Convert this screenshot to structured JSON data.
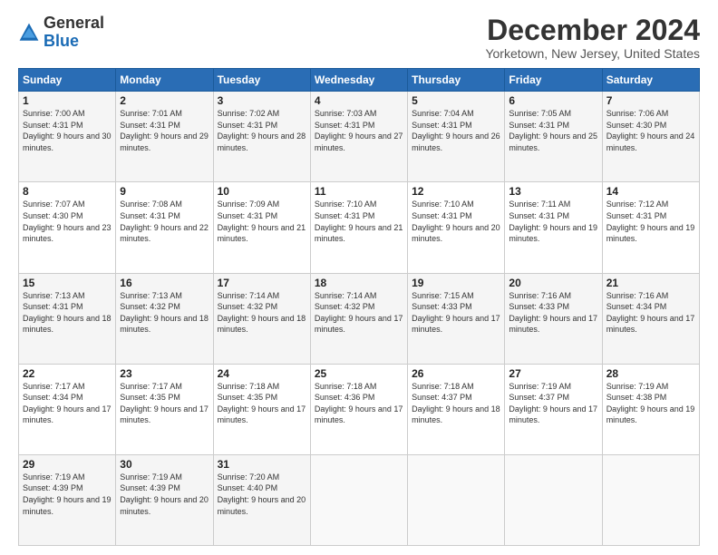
{
  "logo": {
    "general": "General",
    "blue": "Blue"
  },
  "title": "December 2024",
  "location": "Yorketown, New Jersey, United States",
  "days_header": [
    "Sunday",
    "Monday",
    "Tuesday",
    "Wednesday",
    "Thursday",
    "Friday",
    "Saturday"
  ],
  "weeks": [
    [
      {
        "day": "1",
        "sunrise": "7:00 AM",
        "sunset": "4:31 PM",
        "daylight": "9 hours and 30 minutes."
      },
      {
        "day": "2",
        "sunrise": "7:01 AM",
        "sunset": "4:31 PM",
        "daylight": "9 hours and 29 minutes."
      },
      {
        "day": "3",
        "sunrise": "7:02 AM",
        "sunset": "4:31 PM",
        "daylight": "9 hours and 28 minutes."
      },
      {
        "day": "4",
        "sunrise": "7:03 AM",
        "sunset": "4:31 PM",
        "daylight": "9 hours and 27 minutes."
      },
      {
        "day": "5",
        "sunrise": "7:04 AM",
        "sunset": "4:31 PM",
        "daylight": "9 hours and 26 minutes."
      },
      {
        "day": "6",
        "sunrise": "7:05 AM",
        "sunset": "4:31 PM",
        "daylight": "9 hours and 25 minutes."
      },
      {
        "day": "7",
        "sunrise": "7:06 AM",
        "sunset": "4:30 PM",
        "daylight": "9 hours and 24 minutes."
      }
    ],
    [
      {
        "day": "8",
        "sunrise": "7:07 AM",
        "sunset": "4:30 PM",
        "daylight": "9 hours and 23 minutes."
      },
      {
        "day": "9",
        "sunrise": "7:08 AM",
        "sunset": "4:31 PM",
        "daylight": "9 hours and 22 minutes."
      },
      {
        "day": "10",
        "sunrise": "7:09 AM",
        "sunset": "4:31 PM",
        "daylight": "9 hours and 21 minutes."
      },
      {
        "day": "11",
        "sunrise": "7:10 AM",
        "sunset": "4:31 PM",
        "daylight": "9 hours and 21 minutes."
      },
      {
        "day": "12",
        "sunrise": "7:10 AM",
        "sunset": "4:31 PM",
        "daylight": "9 hours and 20 minutes."
      },
      {
        "day": "13",
        "sunrise": "7:11 AM",
        "sunset": "4:31 PM",
        "daylight": "9 hours and 19 minutes."
      },
      {
        "day": "14",
        "sunrise": "7:12 AM",
        "sunset": "4:31 PM",
        "daylight": "9 hours and 19 minutes."
      }
    ],
    [
      {
        "day": "15",
        "sunrise": "7:13 AM",
        "sunset": "4:31 PM",
        "daylight": "9 hours and 18 minutes."
      },
      {
        "day": "16",
        "sunrise": "7:13 AM",
        "sunset": "4:32 PM",
        "daylight": "9 hours and 18 minutes."
      },
      {
        "day": "17",
        "sunrise": "7:14 AM",
        "sunset": "4:32 PM",
        "daylight": "9 hours and 18 minutes."
      },
      {
        "day": "18",
        "sunrise": "7:14 AM",
        "sunset": "4:32 PM",
        "daylight": "9 hours and 17 minutes."
      },
      {
        "day": "19",
        "sunrise": "7:15 AM",
        "sunset": "4:33 PM",
        "daylight": "9 hours and 17 minutes."
      },
      {
        "day": "20",
        "sunrise": "7:16 AM",
        "sunset": "4:33 PM",
        "daylight": "9 hours and 17 minutes."
      },
      {
        "day": "21",
        "sunrise": "7:16 AM",
        "sunset": "4:34 PM",
        "daylight": "9 hours and 17 minutes."
      }
    ],
    [
      {
        "day": "22",
        "sunrise": "7:17 AM",
        "sunset": "4:34 PM",
        "daylight": "9 hours and 17 minutes."
      },
      {
        "day": "23",
        "sunrise": "7:17 AM",
        "sunset": "4:35 PM",
        "daylight": "9 hours and 17 minutes."
      },
      {
        "day": "24",
        "sunrise": "7:18 AM",
        "sunset": "4:35 PM",
        "daylight": "9 hours and 17 minutes."
      },
      {
        "day": "25",
        "sunrise": "7:18 AM",
        "sunset": "4:36 PM",
        "daylight": "9 hours and 17 minutes."
      },
      {
        "day": "26",
        "sunrise": "7:18 AM",
        "sunset": "4:37 PM",
        "daylight": "9 hours and 18 minutes."
      },
      {
        "day": "27",
        "sunrise": "7:19 AM",
        "sunset": "4:37 PM",
        "daylight": "9 hours and 17 minutes."
      },
      {
        "day": "28",
        "sunrise": "7:19 AM",
        "sunset": "4:38 PM",
        "daylight": "9 hours and 19 minutes."
      }
    ],
    [
      {
        "day": "29",
        "sunrise": "7:19 AM",
        "sunset": "4:39 PM",
        "daylight": "9 hours and 19 minutes."
      },
      {
        "day": "30",
        "sunrise": "7:19 AM",
        "sunset": "4:39 PM",
        "daylight": "9 hours and 20 minutes."
      },
      {
        "day": "31",
        "sunrise": "7:20 AM",
        "sunset": "4:40 PM",
        "daylight": "9 hours and 20 minutes."
      },
      null,
      null,
      null,
      null
    ]
  ],
  "labels": {
    "sunrise": "Sunrise:",
    "sunset": "Sunset:",
    "daylight": "Daylight:"
  }
}
